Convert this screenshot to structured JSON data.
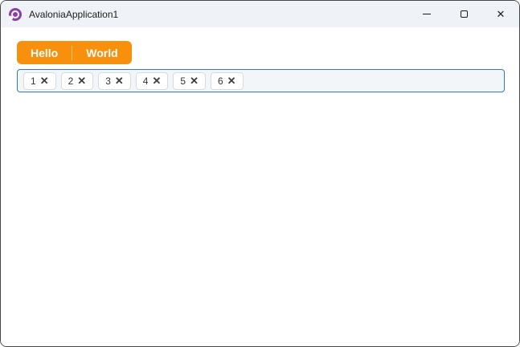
{
  "window": {
    "title": "AvaloniaApplication1",
    "app_icon": "avalonia-logo-icon",
    "caption_buttons": {
      "minimize": "minimize-icon",
      "maximize": "maximize-icon",
      "close": "close-icon",
      "close_glyph": "✕"
    }
  },
  "tab_strip": {
    "tabs": [
      {
        "label": "Hello"
      },
      {
        "label": "World"
      }
    ]
  },
  "tags_input": {
    "chips": [
      {
        "value": "1",
        "remove_glyph": "✕"
      },
      {
        "value": "2",
        "remove_glyph": "✕"
      },
      {
        "value": "3",
        "remove_glyph": "✕"
      },
      {
        "value": "4",
        "remove_glyph": "✕"
      },
      {
        "value": "5",
        "remove_glyph": "✕"
      },
      {
        "value": "6",
        "remove_glyph": "✕"
      }
    ]
  },
  "colors": {
    "accent_orange": "#f7910d",
    "tags_border_blue": "#2e7db2",
    "titlebar_bg": "#eff3f8",
    "logo_purple": "#8b3fa8"
  }
}
